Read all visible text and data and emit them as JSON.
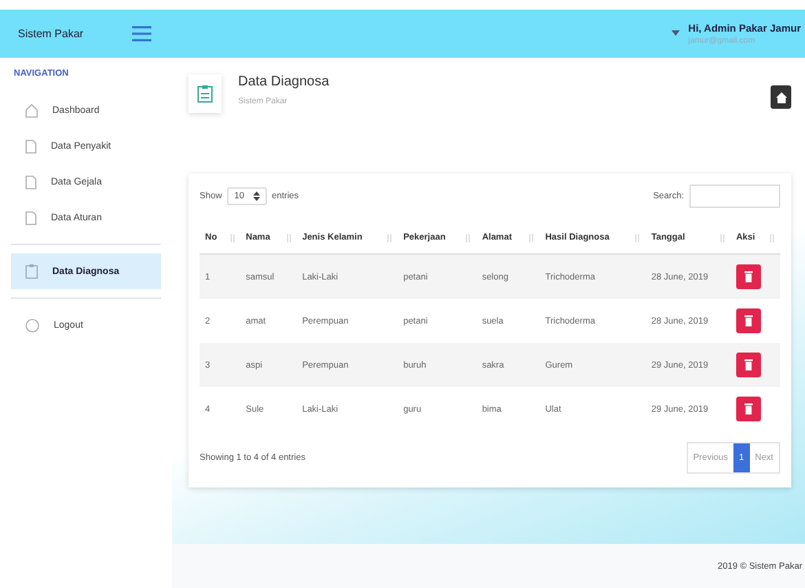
{
  "topbar": {
    "brand": "Sistem Pakar",
    "user_name": "Hi, Admin Pakar Jamur",
    "user_email": "jamur@gmail.com"
  },
  "sidebar": {
    "heading": "NAVIGATION",
    "items": [
      {
        "label": "Dashboard",
        "kind": "home",
        "selected": false
      },
      {
        "label": "Data Penyakit",
        "kind": "page",
        "selected": false
      },
      {
        "label": "Data Gejala",
        "kind": "page",
        "selected": false
      },
      {
        "label": "Data Aturan",
        "kind": "page",
        "selected": false
      },
      {
        "label": "Data Diagnosa",
        "kind": "page",
        "selected": true
      },
      {
        "label": "Logout",
        "kind": "logout",
        "selected": false
      }
    ]
  },
  "page_header": {
    "title": "Data Diagnosa",
    "subtitle": "Sistem Pakar"
  },
  "table_controls": {
    "show_label": "Show",
    "page_size": "10",
    "entries_label": "entries",
    "search_label": "Search:"
  },
  "table": {
    "columns": [
      "No",
      "Nama",
      "Jenis Kelamin",
      "Pekerjaan",
      "Alamat",
      "Hasil Diagnosa",
      "Tanggal",
      "Aksi"
    ],
    "rows": [
      [
        "1",
        "samsul",
        "Laki-Laki",
        "petani",
        "selong",
        "Trichoderma",
        "28 June, 2019"
      ],
      [
        "2",
        "amat",
        "Perempuan",
        "petani",
        "suela",
        "Trichoderma",
        "28 June, 2019"
      ],
      [
        "3",
        "aspi",
        "Perempuan",
        "buruh",
        "sakra",
        "Gurem",
        "29 June, 2019"
      ],
      [
        "4",
        "Sule",
        "Laki-Laki",
        "guru",
        "bima",
        "Ulat",
        "29 June, 2019"
      ]
    ]
  },
  "table_footer": {
    "info": "Showing 1 to 4 of 4 entries",
    "pages": [
      {
        "label": "Previous",
        "selected": false
      },
      {
        "label": "1",
        "selected": true
      },
      {
        "label": "Next",
        "selected": false
      }
    ]
  },
  "footer": {
    "text": "2019 © Sistem Pakar"
  }
}
